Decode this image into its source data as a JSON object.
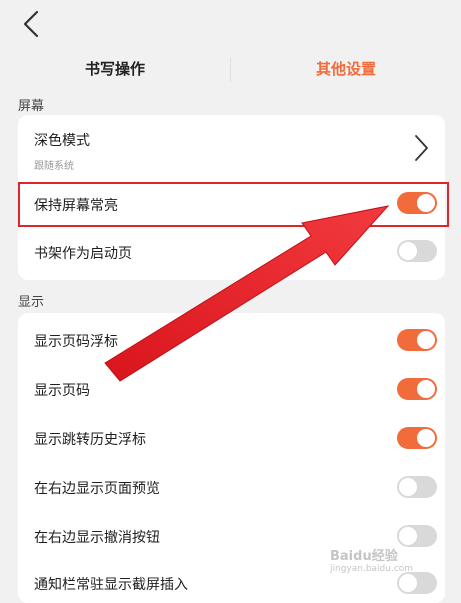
{
  "header": {
    "back_icon": "chevron-left-icon"
  },
  "tabs": [
    {
      "label": "书写操作",
      "active": false
    },
    {
      "label": "其他设置",
      "active": true
    }
  ],
  "sections": [
    {
      "title": "屏幕",
      "rows": [
        {
          "label": "深色模式",
          "sublabel": "跟随系统",
          "control": "chevron"
        },
        {
          "label": "保持屏幕常亮",
          "control": "toggle",
          "on": true
        },
        {
          "label": "书架作为启动页",
          "control": "toggle",
          "on": false
        }
      ]
    },
    {
      "title": "显示",
      "rows": [
        {
          "label": "显示页码浮标",
          "control": "toggle",
          "on": true
        },
        {
          "label": "显示页码",
          "control": "toggle",
          "on": true
        },
        {
          "label": "显示跳转历史浮标",
          "control": "toggle",
          "on": true
        },
        {
          "label": "在右边显示页面预览",
          "control": "toggle",
          "on": false
        },
        {
          "label": "在右边显示撤消按钮",
          "control": "toggle",
          "on": false
        },
        {
          "label": "通知栏常驻显示截屏插入",
          "control": "toggle",
          "on": false
        }
      ]
    }
  ],
  "colors": {
    "accent": "#f26b3a",
    "toggle_off": "#d9d9d9",
    "highlight": "#e0242c",
    "background": "#f1f1f1"
  },
  "watermark": {
    "text": "Baidu经验",
    "sub": "jingyan.baidu.com"
  }
}
